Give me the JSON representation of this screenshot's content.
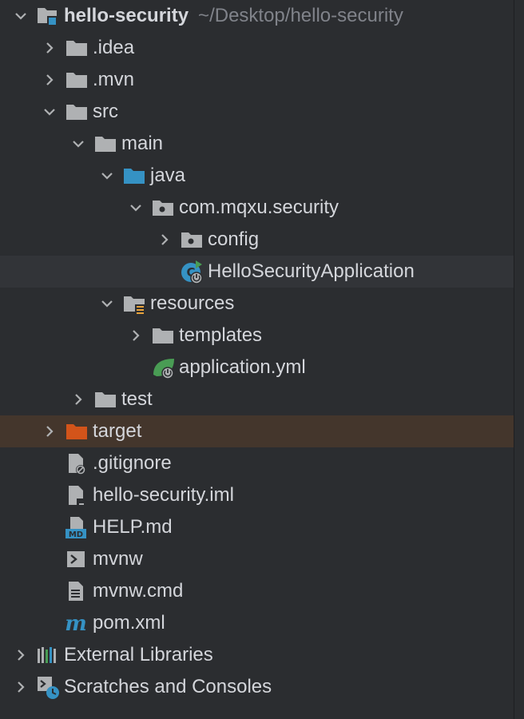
{
  "tree": {
    "root": {
      "label": "hello-security",
      "path": "~/Desktop/hello-security",
      "icon": "module-folder-icon"
    },
    "idea": {
      "label": ".idea",
      "icon": "folder-icon"
    },
    "mvn": {
      "label": ".mvn",
      "icon": "folder-icon"
    },
    "src": {
      "label": "src",
      "icon": "folder-icon"
    },
    "main": {
      "label": "main",
      "icon": "folder-icon"
    },
    "java": {
      "label": "java",
      "icon": "source-root-folder-icon"
    },
    "package": {
      "label": "com.mqxu.security",
      "icon": "package-icon"
    },
    "config": {
      "label": "config",
      "icon": "package-icon"
    },
    "app_class": {
      "label": "HelloSecurityApplication",
      "icon": "spring-boot-class-icon"
    },
    "resources": {
      "label": "resources",
      "icon": "resources-folder-icon"
    },
    "templates": {
      "label": "templates",
      "icon": "folder-icon"
    },
    "app_yml": {
      "label": "application.yml",
      "icon": "spring-config-icon"
    },
    "test": {
      "label": "test",
      "icon": "folder-icon"
    },
    "target": {
      "label": "target",
      "icon": "excluded-folder-icon"
    },
    "gitignore": {
      "label": ".gitignore",
      "icon": "ignore-file-icon"
    },
    "iml": {
      "label": "hello-security.iml",
      "icon": "module-file-icon"
    },
    "help": {
      "label": "HELP.md",
      "icon": "markdown-file-icon"
    },
    "mvnw": {
      "label": "mvnw",
      "icon": "shell-script-icon"
    },
    "mvnw_cmd": {
      "label": "mvnw.cmd",
      "icon": "text-file-icon"
    },
    "pom": {
      "label": "pom.xml",
      "icon": "maven-icon"
    },
    "ext_libs": {
      "label": "External Libraries",
      "icon": "libraries-icon"
    },
    "scratches": {
      "label": "Scratches and Consoles",
      "icon": "scratches-icon"
    }
  },
  "colors": {
    "background": "#2b2d30",
    "selected_row": "#323438",
    "excluded_row": "#44362c",
    "text": "#d4d6db",
    "path_text": "#80838a",
    "folder": "#afb1b3",
    "source_root": "#3592c4",
    "excluded_folder": "#d3541a",
    "spring_green": "#499c54"
  }
}
